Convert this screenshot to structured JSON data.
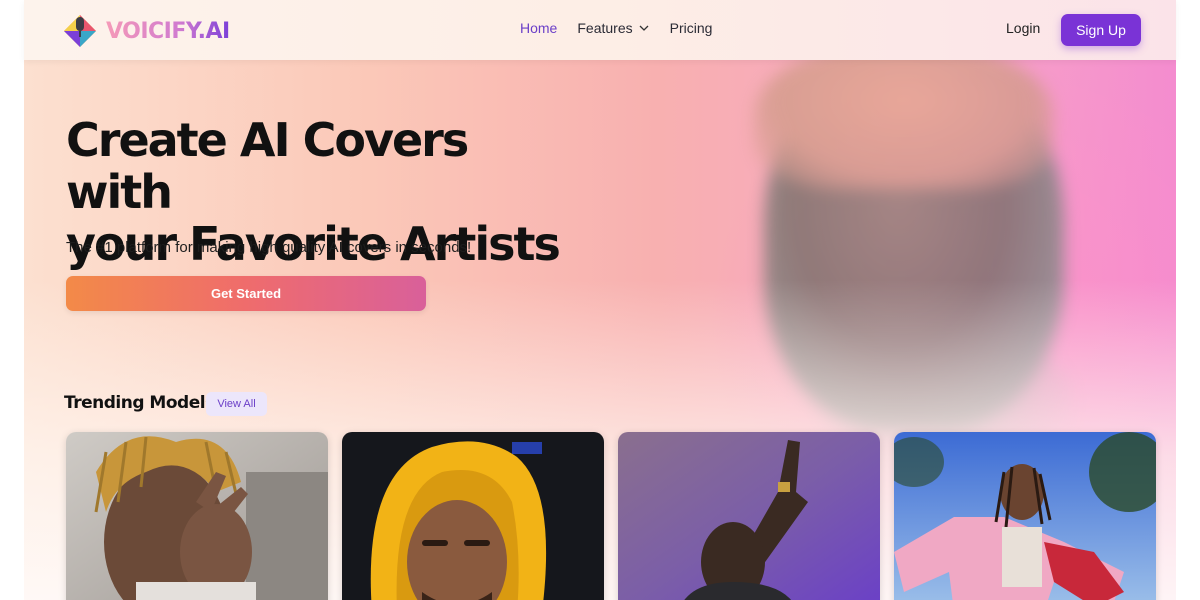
{
  "brand": {
    "name": "VOICIFY.AI",
    "accent": "#7a33d6"
  },
  "nav": {
    "items": [
      {
        "label": "Home",
        "active": true
      },
      {
        "label": "Features",
        "dropdown": true
      },
      {
        "label": "Pricing"
      }
    ],
    "login_label": "Login",
    "signup_label": "Sign Up"
  },
  "hero": {
    "title_line1": "Create AI Covers with",
    "title_line2": "your Favorite Artists",
    "subtitle": "The #1 platform for making high quality AI covers in seconds!",
    "cta_label": "Get Started"
  },
  "trending": {
    "title": "Trending Models",
    "view_all_label": "View All",
    "cards": [
      {
        "icon": "artist-photo-dreadlocks"
      },
      {
        "icon": "artist-photo-yellow-hoodie"
      },
      {
        "icon": "artist-photo-pointing-up"
      },
      {
        "icon": "artist-photo-pink-jacket"
      }
    ]
  }
}
